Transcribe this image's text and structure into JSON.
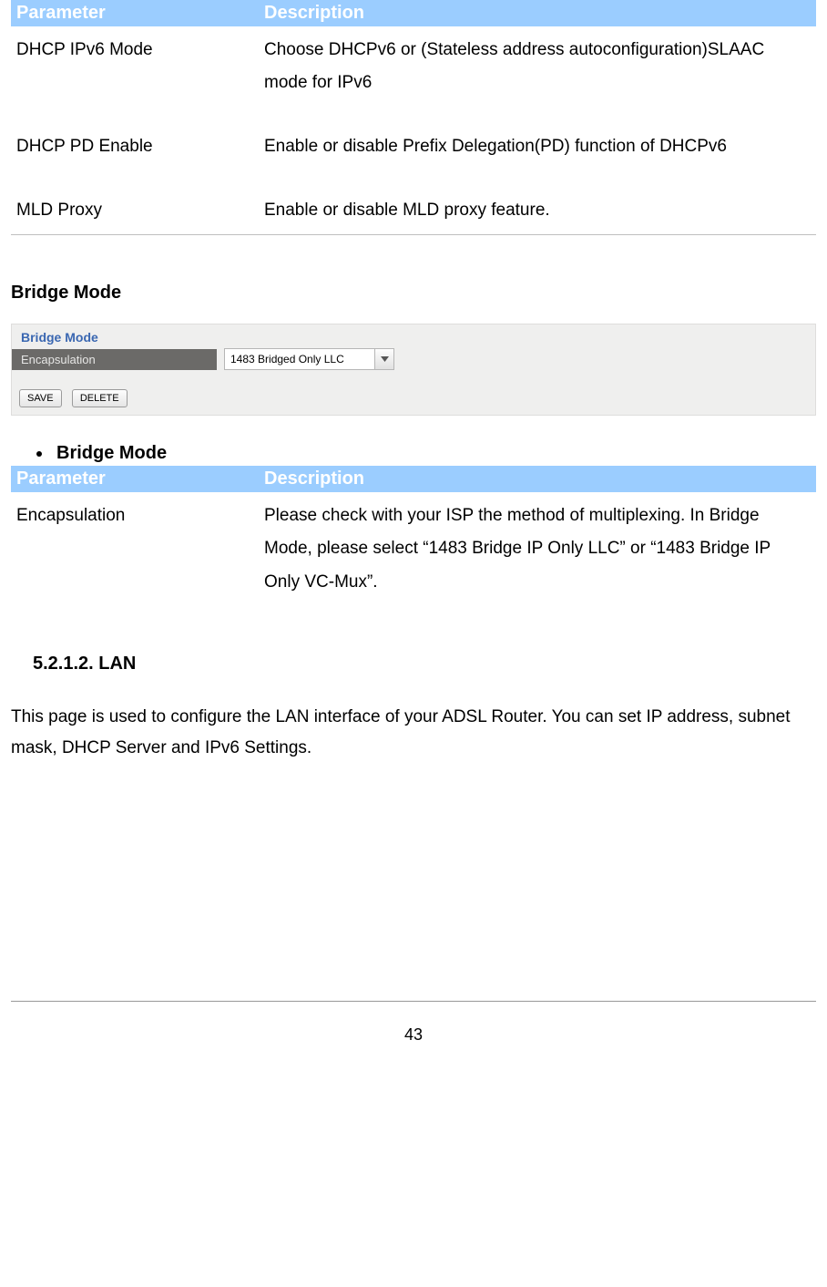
{
  "table1": {
    "header_param": "Parameter",
    "header_desc": "Description",
    "rows": [
      {
        "param": "DHCP IPv6 Mode",
        "desc": "Choose DHCPv6 or (Stateless address autoconfiguration)SLAAC mode for IPv6"
      },
      {
        "param": "DHCP PD Enable",
        "desc": "Enable or disable Prefix Delegation(PD) function of DHCPv6"
      },
      {
        "param": "MLD Proxy",
        "desc": "Enable or disable MLD proxy feature."
      }
    ]
  },
  "section_bridge_heading": "Bridge Mode",
  "panel": {
    "title": "Bridge Mode",
    "row_label": "Encapsulation",
    "select_value": "1483 Bridged Only LLC",
    "btn_save": "SAVE",
    "btn_delete": "DELETE"
  },
  "bullet_bridge": "Bridge Mode",
  "table2": {
    "header_param": "Parameter",
    "header_desc": "Description",
    "rows": [
      {
        "param": "Encapsulation",
        "desc": "Please check with your ISP the method of multiplexing. In Bridge Mode, please select “1483 Bridge IP Only LLC” or “1483 Bridge IP Only VC-Mux”."
      }
    ]
  },
  "subsection_heading": "5.2.1.2. LAN",
  "lan_paragraph": "This page is used to configure the LAN interface of your ADSL Router. You can set IP address, subnet mask, DHCP Server and IPv6 Settings.",
  "page_number": "43"
}
